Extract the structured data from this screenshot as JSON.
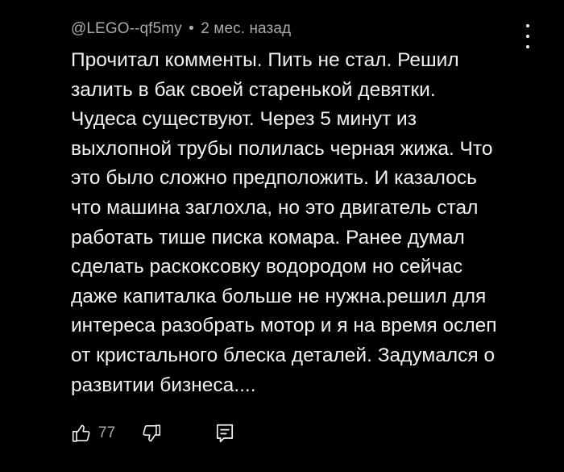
{
  "comment": {
    "author": "@LEGO--qf5my",
    "separator": "•",
    "time": "2 мес. назад",
    "text_lines": [
      "Прочитал комменты. Пить не стал. Решил",
      "залить в бак своей старенькой девятки.",
      "Чудеса существуют. Через 5 минут из",
      "выхлопной трубы полилась черная жижа. Что",
      "это было сложно предположить. И казалось",
      "что машина заглохла, но это двигатель стал",
      "работать тише писка комара. Ранее думал",
      "сделать раскоксовку водородом но сейчас",
      "даже капиталка больше не нужна.решил для",
      "интереса разобрать мотор и я на время ослеп",
      "от кристального блеска деталей. Задумался о",
      "развитии бизнеса...."
    ],
    "likes": "77"
  },
  "icons": {
    "menu": "more-vertical-icon",
    "like": "thumb-up-icon",
    "dislike": "thumb-down-icon",
    "reply": "reply-comment-icon"
  },
  "colors": {
    "background": "#000000",
    "text": "#f1f1f1",
    "secondary": "#aaaaaa"
  }
}
